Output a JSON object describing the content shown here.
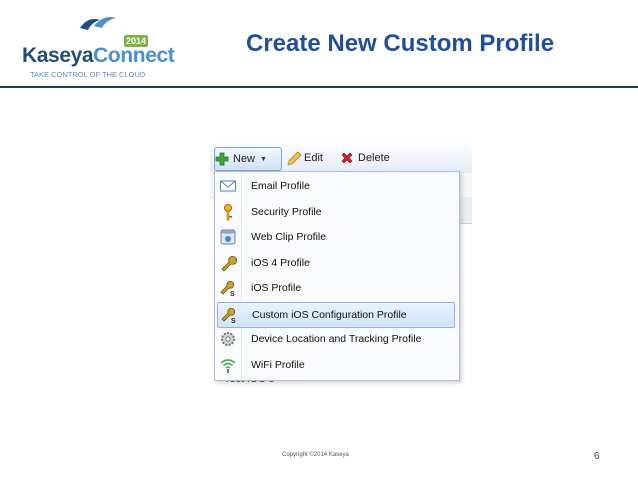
{
  "header": {
    "logo_brand_part1": "Kaseya",
    "logo_brand_part2": "Connect",
    "logo_year": "2014",
    "logo_tagline": "TAKE CONTROL OF THE CLOUD",
    "title": "Create New Custom Profile"
  },
  "toolbar": {
    "new_label": "New",
    "edit_label": "Edit",
    "delete_label": "Delete"
  },
  "menu": {
    "items": [
      {
        "label": "Email Profile",
        "icon": "envelope-icon"
      },
      {
        "label": "Security Profile",
        "icon": "key-icon"
      },
      {
        "label": "Web Clip Profile",
        "icon": "web-clip-icon"
      },
      {
        "label": "iOS 4 Profile",
        "icon": "wrench-icon"
      },
      {
        "label": "iOS Profile",
        "icon": "wrench-s-icon"
      },
      {
        "label": "Custom iOS Configuration Profile",
        "icon": "wrench-s-icon",
        "selected": true
      },
      {
        "label": "Device Location and Tracking Profile",
        "icon": "gear-icon"
      },
      {
        "label": "WiFi Profile",
        "icon": "wifi-icon"
      }
    ]
  },
  "background_row": "Test iOS 5",
  "footer": {
    "copyright": "Copyright ©2014 Kaseya",
    "page_number": "6"
  },
  "colors": {
    "title": "#1f4e9a",
    "rule": "#1f3864",
    "selection": "#cfe3fa",
    "logo_green": "#7cb342"
  }
}
